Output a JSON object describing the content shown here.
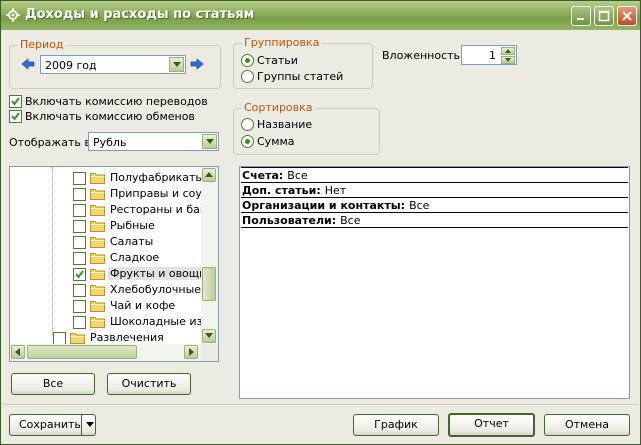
{
  "window": {
    "title": "Доходы и расходы по статьям"
  },
  "period": {
    "label": "Период",
    "value": "2009 год"
  },
  "commission": {
    "transfers": {
      "label": "Включать комиссию переводов",
      "checked": true
    },
    "exchanges": {
      "label": "Включать комиссию обменов",
      "checked": true
    }
  },
  "display": {
    "label": "Отображать в:",
    "value": "Рубль"
  },
  "grouping": {
    "label": "Группировка",
    "options": [
      {
        "label": "Статьи",
        "selected": true
      },
      {
        "label": "Группы статей",
        "selected": false
      }
    ]
  },
  "nesting": {
    "label": "Вложенность:",
    "value": "1"
  },
  "sorting": {
    "label": "Сортировка",
    "options": [
      {
        "label": "Название",
        "selected": false
      },
      {
        "label": "Сумма",
        "selected": true
      }
    ]
  },
  "tree": {
    "items": [
      {
        "label": "Полуфабрикаты",
        "checked": false
      },
      {
        "label": "Приправы и соусы",
        "checked": false
      },
      {
        "label": "Рестораны и банкеты",
        "checked": false
      },
      {
        "label": "Рыбные",
        "checked": false
      },
      {
        "label": "Салаты",
        "checked": false
      },
      {
        "label": "Сладкое",
        "checked": false
      },
      {
        "label": "Фрукты и овощи",
        "checked": true
      },
      {
        "label": "Хлебобулочные изделия",
        "checked": false
      },
      {
        "label": "Чай и кофе",
        "checked": false
      },
      {
        "label": "Шоколадные изделия",
        "checked": false
      },
      {
        "label": "Развлечения",
        "checked": false
      }
    ]
  },
  "tree_buttons": {
    "all": "Все",
    "clear": "Очистить"
  },
  "info": {
    "rows": [
      {
        "key": "Счета:",
        "value": "Все"
      },
      {
        "key": "Доп. статьи:",
        "value": "Нет"
      },
      {
        "key": "Организации и контакты:",
        "value": "Все"
      },
      {
        "key": "Пользователи:",
        "value": "Все"
      }
    ]
  },
  "footer": {
    "save": "Сохранить",
    "chart": "График",
    "report": "Отчет",
    "cancel": "Отмена"
  },
  "colors": {
    "titlebar": "#8fb05c",
    "group_label": "#c0540a",
    "window_bg": "#ecebe2"
  }
}
